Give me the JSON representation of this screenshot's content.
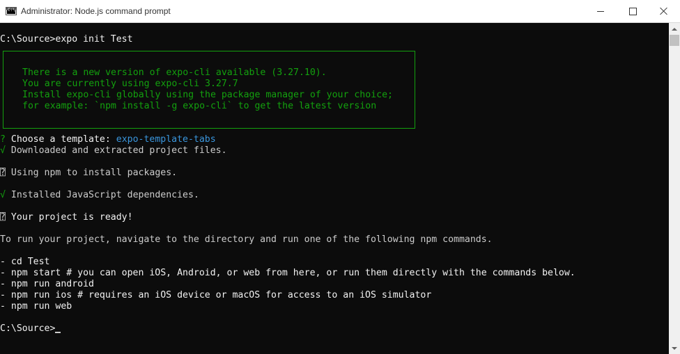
{
  "window": {
    "title": "Administrator: Node.js command prompt",
    "icon": "cmd-icon",
    "icon_text": "C:\\"
  },
  "colors": {
    "background": "#0c0c0c",
    "text": "#cccccc",
    "bright": "#f2f2f2",
    "green": "#13a10e",
    "cyan": "#3a96dd"
  },
  "console": {
    "command_line": "C:\\Source>expo init Test",
    "notice": [
      "There is a new version of expo-cli available (3.27.10).",
      "You are currently using expo-cli 3.27.7",
      "Install expo-cli globally using the package manager of your choice;",
      "for example: `npm install -g expo-cli` to get the latest version"
    ],
    "template_prefix": "?",
    "template_label": " Choose a template: ",
    "template_value": "expo-template-tabs",
    "downloaded_mark": "√",
    "downloaded_text": " Downloaded and extracted project files.",
    "npm_mark": "⍰",
    "npm_text": " Using npm to install packages.",
    "installed_mark": "√",
    "installed_text": " Installed JavaScript dependencies.",
    "ready_mark": "⍰",
    "ready_text": " Your project is ready!",
    "instructions": "To run your project, navigate to the directory and run one of the following npm commands.",
    "commands": [
      "- cd Test",
      "- npm start # you can open iOS, Android, or web from here, or run them directly with the commands below.",
      "- npm run android",
      "- npm run ios # requires an iOS device or macOS for access to an iOS simulator",
      "- npm run web"
    ],
    "final_prompt": "C:\\Source>"
  }
}
